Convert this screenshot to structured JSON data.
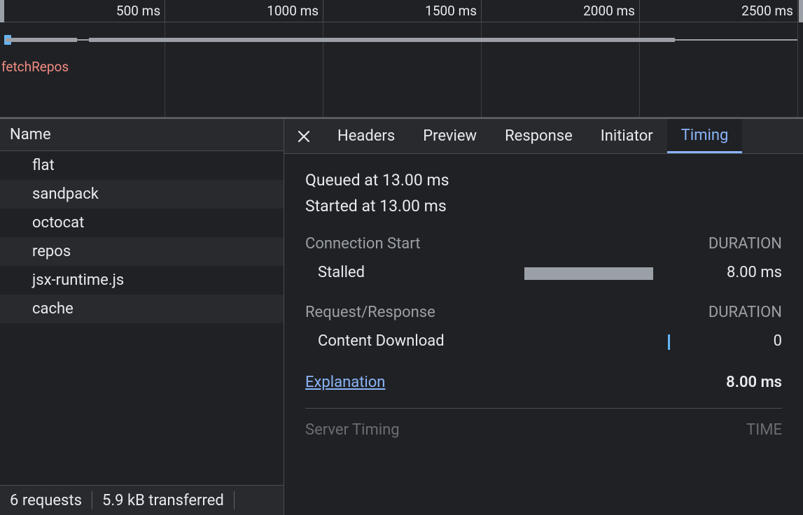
{
  "timeline": {
    "ticks": [
      "500 ms",
      "1000 ms",
      "1500 ms",
      "2000 ms",
      "2500 ms"
    ],
    "label": "fetchRepos"
  },
  "name_header": "Name",
  "requests": [
    "flat",
    "sandpack",
    "octocat",
    "repos",
    "jsx-runtime.js",
    "cache"
  ],
  "status_bar": {
    "count": "6 requests",
    "transferred": "5.9 kB transferred"
  },
  "tabs": [
    "Headers",
    "Preview",
    "Response",
    "Initiator",
    "Timing"
  ],
  "timing": {
    "queued": "Queued at 13.00 ms",
    "started": "Started at 13.00 ms",
    "conn_head": "Connection Start",
    "duration_head": "DURATION",
    "stalled_label": "Stalled",
    "stalled_value": "8.00 ms",
    "rr_head": "Request/Response",
    "cd_label": "Content Download",
    "cd_value": "0",
    "explain": "Explanation",
    "total": "8.00 ms",
    "server_timing": "Server Timing",
    "time": "TIME"
  }
}
